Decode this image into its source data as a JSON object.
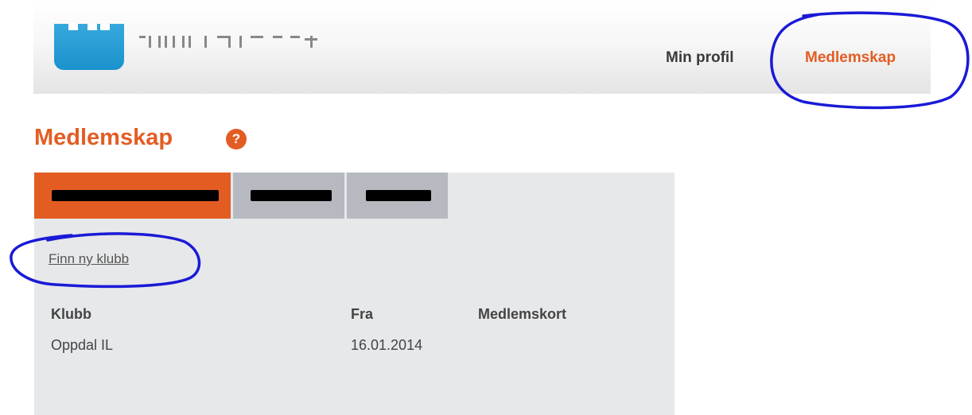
{
  "header": {
    "nav": {
      "profile_label": "Min profil",
      "membership_label": "Medlemskap"
    }
  },
  "page": {
    "title": "Medlemskap",
    "help_icon_glyph": "?"
  },
  "panel": {
    "tabs": [
      {
        "label": "",
        "active": true
      },
      {
        "label": "",
        "active": false
      },
      {
        "label": "",
        "active": false
      }
    ],
    "find_club_link": "Finn ny klubb",
    "table": {
      "headers": [
        "Klubb",
        "Fra",
        "Medlemskort"
      ],
      "rows": [
        [
          "Oppdal IL",
          "16.01.2014",
          ""
        ]
      ]
    }
  },
  "colors": {
    "accent": "#e35d23",
    "tab_inactive": "#b6b9bf",
    "panel_bg": "#e7e8ea",
    "annotation": "#1a1ad6",
    "logo_blue": "#1b92cd"
  }
}
